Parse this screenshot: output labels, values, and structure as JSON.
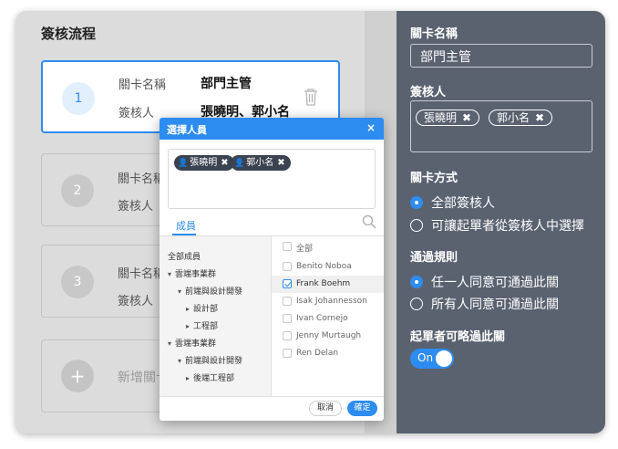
{
  "flow": {
    "title": "簽核流程",
    "steps": [
      {
        "number": "1",
        "name_label": "關卡名稱",
        "name_value": "部門主管",
        "approver_label": "簽核人",
        "approver_value": "張曉明、郭小名"
      },
      {
        "number": "2",
        "name_label": "關卡名稱",
        "approver_label": "簽核人"
      },
      {
        "number": "3",
        "name_label": "關卡名稱",
        "approver_label": "簽核人"
      }
    ],
    "add_symbol": "+",
    "add_label": "新增關卡"
  },
  "panel": {
    "name_label": "關卡名稱",
    "name_value": "部門主管",
    "approvers_label": "簽核人",
    "approvers": [
      "張曉明",
      "郭小名"
    ],
    "tag_close": "✖",
    "mode_label": "關卡方式",
    "mode_options": [
      "全部簽核人",
      "可讓起單者從簽核人中選擇"
    ],
    "mode_selected": 0,
    "rule_label": "通過規則",
    "rule_options": [
      "任一人同意可通過此關",
      "所有人同意可通過此關"
    ],
    "rule_selected": 0,
    "skip_label": "起單者可略過此關",
    "skip_toggle": "On"
  },
  "modal": {
    "title": "選擇人員",
    "close": "×",
    "selected": [
      "張曉明",
      "郭小名"
    ],
    "chip_close": "✖",
    "tab": "成員",
    "tree": [
      {
        "label": "全部成員",
        "level": 0,
        "caret": ""
      },
      {
        "label": "雲端事業群",
        "level": 1,
        "caret": "▾"
      },
      {
        "label": "前端與設計開發",
        "level": 2,
        "caret": "▾"
      },
      {
        "label": "設計部",
        "level": 3,
        "caret": "▸"
      },
      {
        "label": "工程部",
        "level": 3,
        "caret": "▸"
      },
      {
        "label": "雲端事業群",
        "level": 1,
        "caret": "▾"
      },
      {
        "label": "前端與設計開發",
        "level": 2,
        "caret": "▾"
      },
      {
        "label": "後端工程部",
        "level": 3,
        "caret": "▸"
      }
    ],
    "people": [
      {
        "name": "全部",
        "checked": false
      },
      {
        "name": "Benito Noboa",
        "checked": false
      },
      {
        "name": "Frank Boehm",
        "checked": true
      },
      {
        "name": "Isak Johannesson",
        "checked": false
      },
      {
        "name": "Ivan Cornejo",
        "checked": false
      },
      {
        "name": "Jenny Murtaugh",
        "checked": false
      },
      {
        "name": "Ren Delan",
        "checked": false
      }
    ],
    "cancel": "取消",
    "confirm": "確定"
  },
  "colors": {
    "accent": "#2d8cf0",
    "panel_bg": "#5a6270",
    "chip_bg": "#3b4250",
    "overlay_bg": "#dcdcdc"
  }
}
